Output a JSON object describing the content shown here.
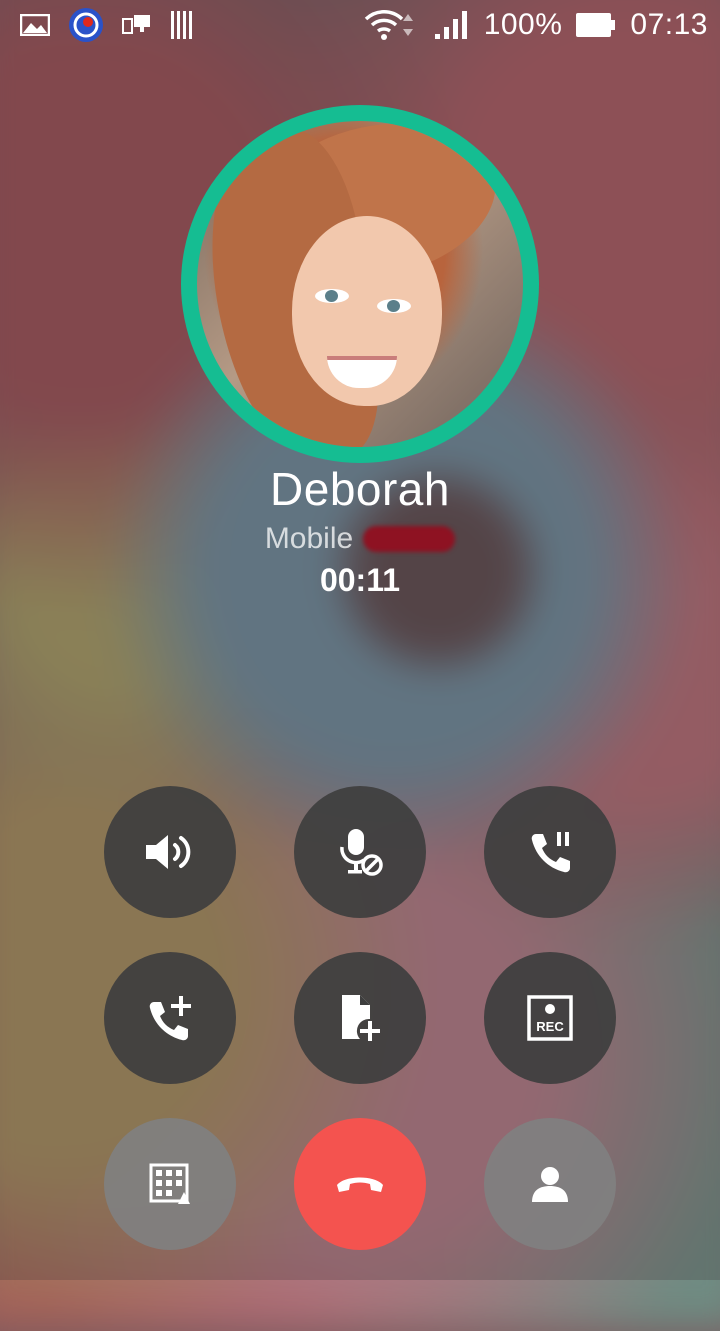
{
  "status_bar": {
    "battery": "100%",
    "time": "07:13"
  },
  "call": {
    "caller_name": "Deborah",
    "number_label": "Mobile",
    "duration": "00:11",
    "accent_color": "#15bd92"
  },
  "controls": {
    "row1": [
      {
        "icon": "speaker-icon"
      },
      {
        "icon": "mute-mic-icon"
      },
      {
        "icon": "hold-call-icon"
      }
    ],
    "row2": [
      {
        "icon": "add-call-icon"
      },
      {
        "icon": "add-note-icon"
      },
      {
        "icon": "record-icon",
        "label": "REC"
      }
    ],
    "row3": [
      {
        "icon": "dialpad-icon"
      },
      {
        "icon": "end-call-icon",
        "color": "#f4534f"
      },
      {
        "icon": "contact-icon"
      }
    ]
  }
}
